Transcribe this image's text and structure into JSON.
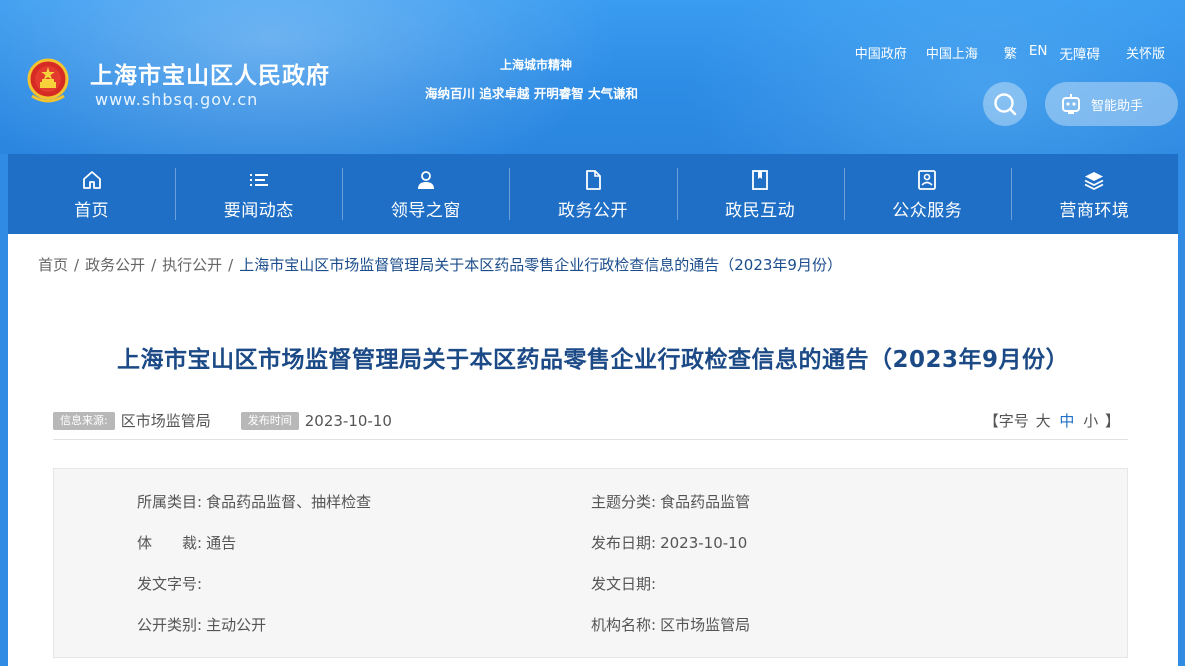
{
  "header": {
    "site_title": "上海市宝山区人民政府",
    "site_url": "www.shbsq.gov.cn",
    "spirit_title": "上海城市精神",
    "spirit_text": "海纳百川 追求卓越 开明睿智 大气谦和",
    "top_links": [
      "中国政府",
      "中国上海",
      "繁",
      "EN",
      "无障碍",
      "关怀版"
    ],
    "assistant_label": "智能助手"
  },
  "nav": [
    {
      "label": "首页",
      "icon": "home-icon"
    },
    {
      "label": "要闻动态",
      "icon": "list-icon"
    },
    {
      "label": "领导之窗",
      "icon": "user-icon"
    },
    {
      "label": "政务公开",
      "icon": "document-icon"
    },
    {
      "label": "政民互动",
      "icon": "bookmark-icon"
    },
    {
      "label": "公众服务",
      "icon": "service-icon"
    },
    {
      "label": "营商环境",
      "icon": "layers-icon"
    }
  ],
  "breadcrumb": [
    "首页",
    "政务公开",
    "执行公开",
    "上海市宝山区市场监督管理局关于本区药品零售企业行政检查信息的通告（2023年9月份）"
  ],
  "article": {
    "title": "上海市宝山区市场监督管理局关于本区药品零售企业行政检查信息的通告（2023年9月份）",
    "source_tag": "信息来源:",
    "source": "区市场监管局",
    "date_tag": "发布时间",
    "date": "2023-10-10",
    "font_size_prefix": "【字号",
    "font_size_options": [
      "大",
      "中",
      "小"
    ],
    "font_size_suffix": "】"
  },
  "info": {
    "category_label": "所属类目:",
    "category_value": "食品药品监督、抽样检查",
    "topic_label": "主题分类:",
    "topic_value": "食品药品监管",
    "genre_label": "体　　裁:",
    "genre_value": "通告",
    "pubdate_label": "发布日期:",
    "pubdate_value": "2023-10-10",
    "docno_label": "发文字号:",
    "docno_value": "",
    "docdate_label": "发文日期:",
    "docdate_value": "",
    "disclosure_label": "公开类别:",
    "disclosure_value": "主动公开",
    "org_label": "机构名称:",
    "org_value": "区市场监管局"
  },
  "colors": {
    "header_blue": "#2d8ce5",
    "nav_blue": "#1f6fc6",
    "title_blue": "#1b4a86"
  }
}
